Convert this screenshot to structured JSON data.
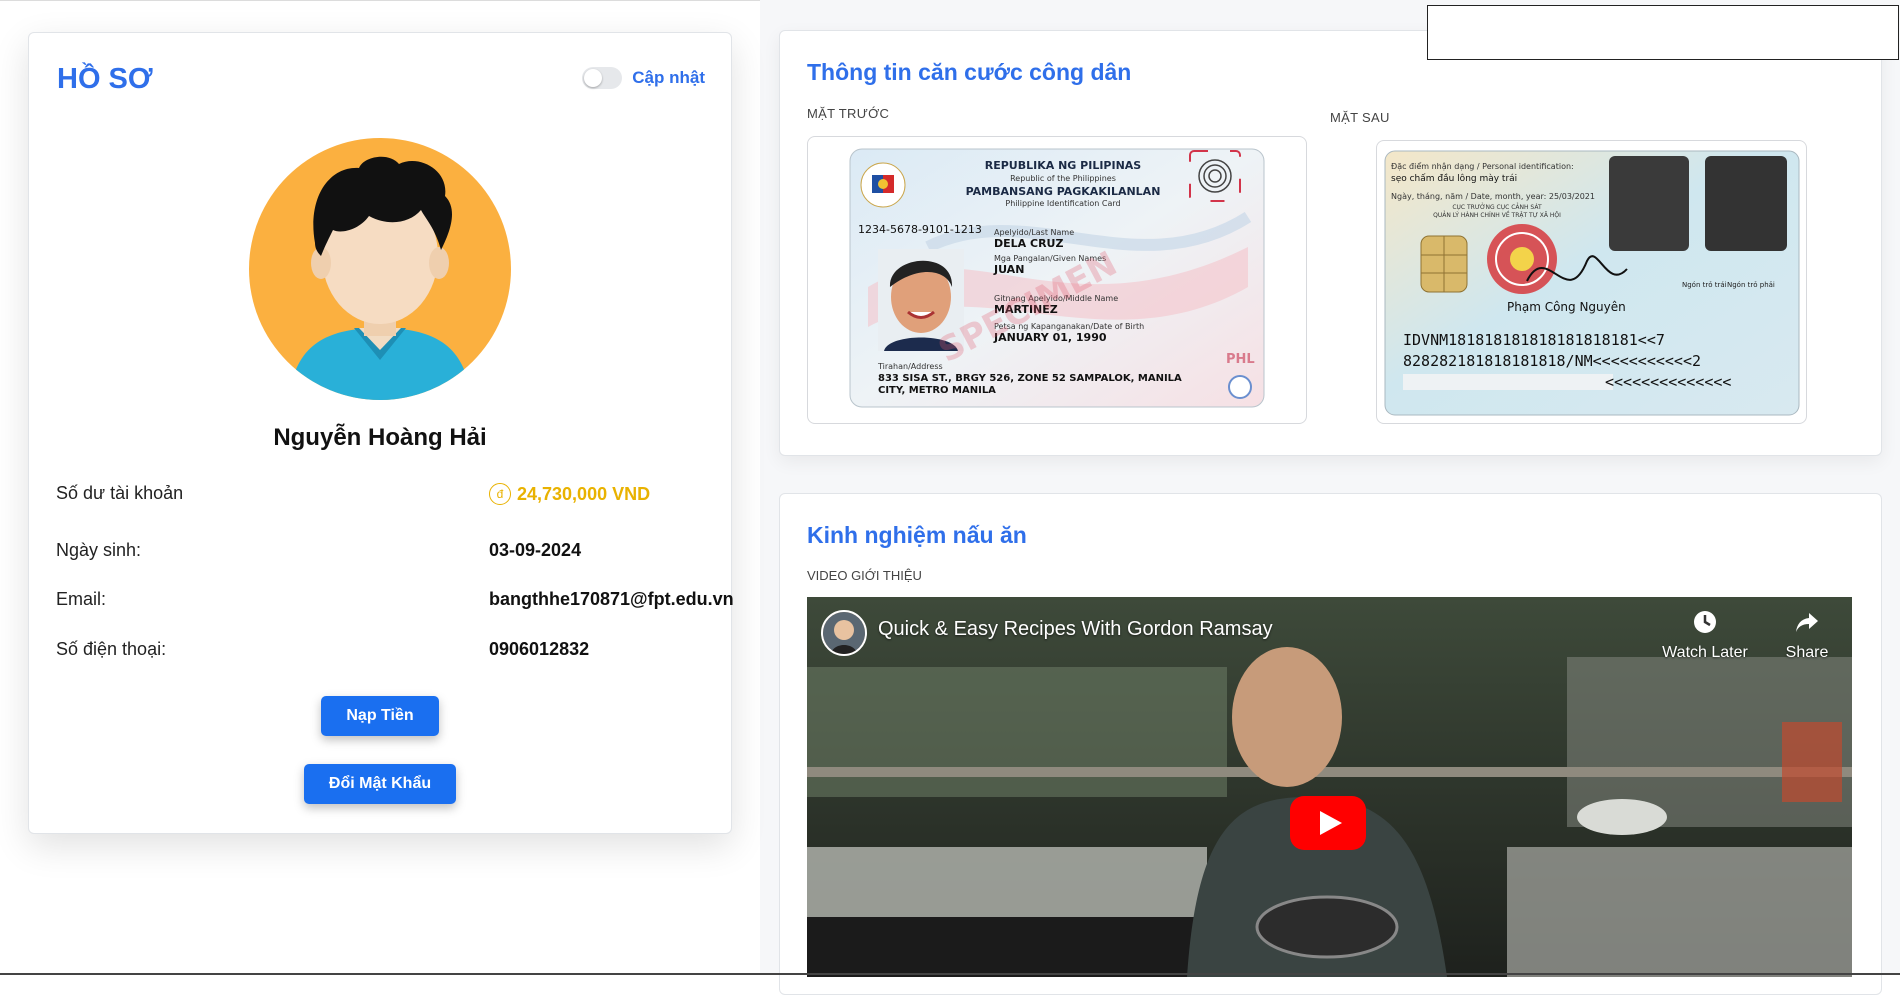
{
  "profile": {
    "title": "HỒ SƠ",
    "toggle_label": "Cập nhật",
    "name": "Nguyễn Hoàng Hải",
    "rows": [
      {
        "label": "Số dư tài khoản",
        "value": "24,730,000 VND"
      },
      {
        "label": "Ngày sinh:",
        "value": "03-09-2024"
      },
      {
        "label": "Email:",
        "value": "bangthhe170871@fpt.edu.vn"
      },
      {
        "label": "Số điện thoại:",
        "value": "0906012832"
      }
    ],
    "coin_symbol": "đ",
    "topup_button": "Nạp Tiền",
    "password_button": "Đổi Mật Khẩu"
  },
  "id_card": {
    "title": "Thông tin căn cước công dân",
    "front_label": "MẶT TRƯỚC",
    "back_label": "MẶT SAU",
    "front": {
      "republic": "REPUBLIKA NG PILIPINAS",
      "republic_en": "Republic of the Philippines",
      "agency": "PAMBANSANG PAGKAKILANLAN",
      "card_name": "Philippine Identification Card",
      "number": "1234-5678-9101-1213",
      "last_name_label": "Apelyido/Last Name",
      "last_name": "DELA CRUZ",
      "given_names_label": "Mga Pangalan/Given Names",
      "given_names": "JUAN",
      "middle_name_label": "Gitnang Apelyido/Middle Name",
      "middle_name": "MARTINEZ",
      "dob_label": "Petsa ng Kapanganakan/Date of Birth",
      "dob": "JANUARY 01, 1990",
      "address_label": "Tirahan/Address",
      "address_1": "833 SISA ST., BRGY 526, ZONE 52 SAMPALOK, MANILA",
      "address_2": "CITY, METRO MANILA",
      "country_code": "PHL",
      "watermark": "SPECIMEN"
    },
    "back": {
      "ident_label": "Đặc điểm nhận dạng / Personal identification:",
      "ident_value": "sẹo chấm đầu lông mày trái",
      "date_line": "Ngày, tháng, năm / Date, month, year: 25/03/2021",
      "office_1": "CỤC TRƯỞNG CỤC CẢNH SÁT",
      "office_2": "QUẢN LÝ HÀNH CHÍNH VỀ TRẬT TỰ XÃ HỘI",
      "signer": "Phạm Công Nguyên",
      "left_finger": "Ngón trỏ trái",
      "right_finger": "Ngón trỏ phải",
      "mrz_1": "IDVNM181818181818181818181<<7",
      "mrz_2": "828282181818181818/NM<<<<<<<<<<<2",
      "mrz_3": "<<<<<<<<<<<<<<"
    }
  },
  "cooking": {
    "title": "Kinh nghiệm nấu ăn",
    "video_label": "VIDEO GIỚI THIỆU",
    "video_title": "Quick & Easy Recipes With Gordon Ramsay",
    "watch_later": "Watch Later",
    "share": "Share"
  },
  "colors": {
    "accent": "#2f6fea",
    "button": "#1a6ff0",
    "balance": "#e9b200",
    "avatar_bg": "#fbb040",
    "youtube_red": "#ff0000"
  }
}
